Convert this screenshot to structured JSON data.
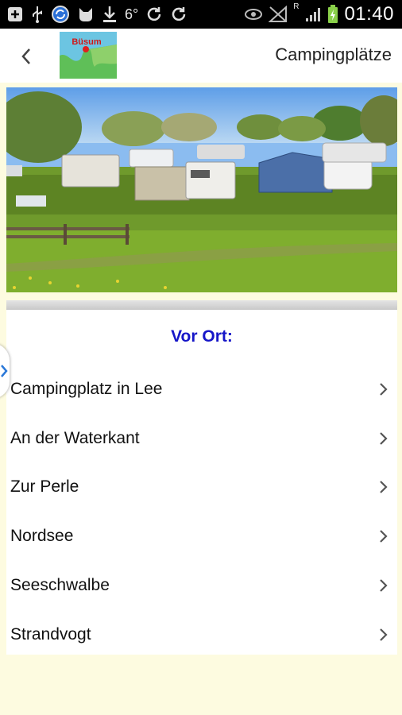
{
  "status_bar": {
    "time": "01:40",
    "notification_icons": [
      "plus-box-icon",
      "usb-icon",
      "sync-app-icon",
      "cat-icon",
      "download-icon",
      "weather-6-icon",
      "refresh-icon",
      "refresh-icon"
    ],
    "weather_temp": "6°",
    "network_label": "R"
  },
  "action_bar": {
    "title": "Campingplätze",
    "logo_text": "Büsum"
  },
  "section": {
    "title": "Vor Ort:"
  },
  "list_items": [
    {
      "label": "Campingplatz in Lee"
    },
    {
      "label": "An der Waterkant"
    },
    {
      "label": "Zur Perle"
    },
    {
      "label": "Nordsee"
    },
    {
      "label": "Seeschwalbe"
    },
    {
      "label": "Strandvogt"
    }
  ],
  "colors": {
    "background": "#fdfbe0",
    "section_title": "#1616c8",
    "status_bar": "#000000"
  }
}
